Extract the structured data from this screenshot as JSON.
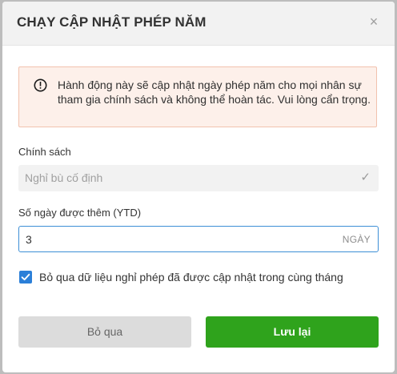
{
  "dialog": {
    "title": "CHẠY CẬP NHẬT PHÉP NĂM",
    "close_label": "×"
  },
  "warning": {
    "icon": "exclamation-circle-icon",
    "text": "Hành động này sẽ cập nhật ngày phép năm cho mọi nhân sự tham gia chính sách và không thể hoàn tác. Vui lòng cẩn trọng."
  },
  "policy": {
    "label": "Chính sách",
    "value": "Nghỉ bù cố định",
    "check_icon": "✓"
  },
  "days": {
    "label": "Số ngày được thêm (YTD)",
    "value": "3",
    "unit": "NGÀY"
  },
  "skip_option": {
    "checked": true,
    "label": "Bỏ qua dữ liệu nghỉ phép đã được cập nhật trong cùng tháng"
  },
  "buttons": {
    "cancel": "Bỏ qua",
    "save": "Lưu lại"
  },
  "colors": {
    "primary_blue": "#2b7fd8",
    "save_green": "#2fa31c",
    "warning_bg": "#fdf0ea",
    "warning_border": "#f2c2ae"
  }
}
